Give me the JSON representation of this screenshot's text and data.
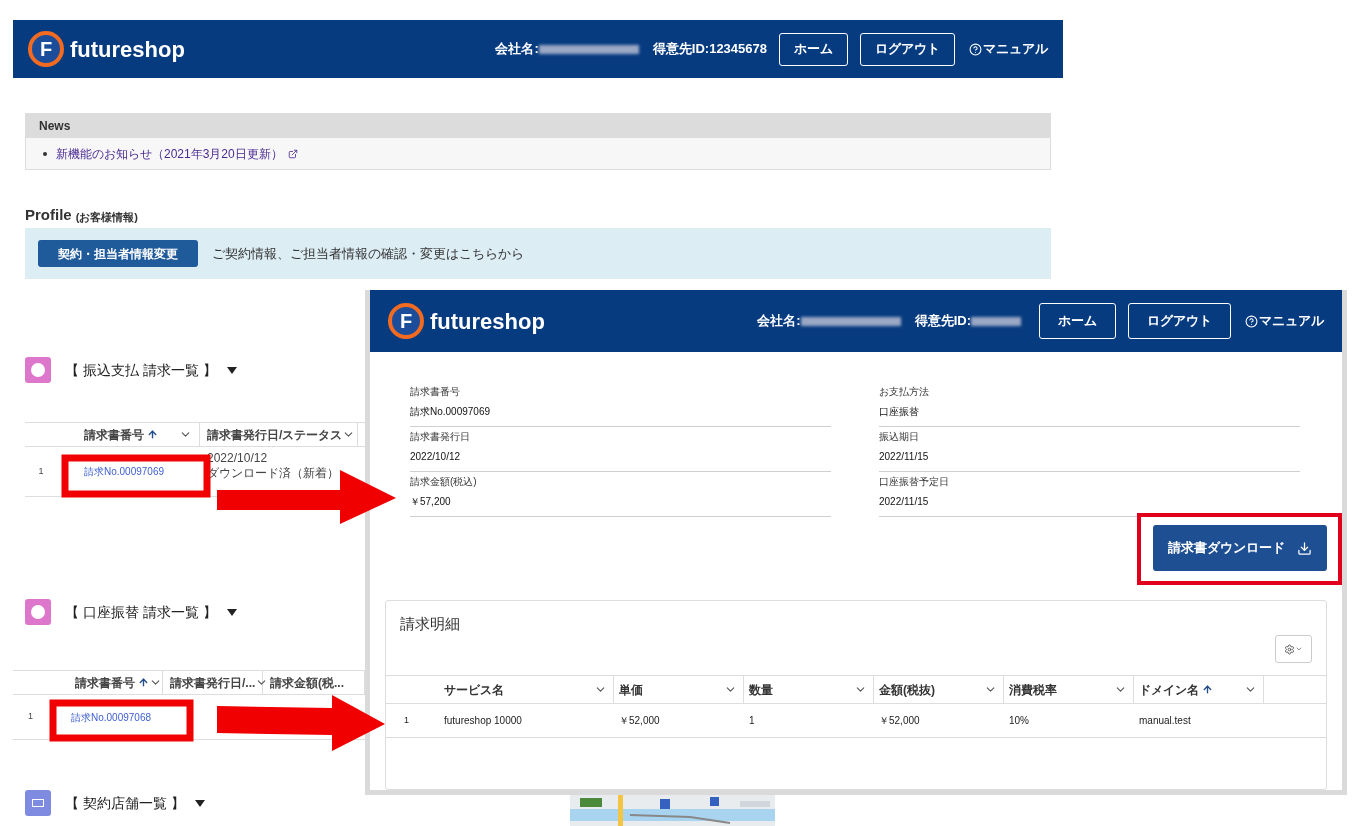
{
  "header": {
    "logo_letter": "F",
    "brand": "futureshop",
    "company_label": "会社名:",
    "customer_id": "得意先ID:12345678",
    "buttons": [
      "ホーム",
      "ログアウト"
    ],
    "manual": "マニュアル"
  },
  "news": {
    "title": "News",
    "items": [
      {
        "text": "新機能のお知らせ（2021年3月20日更新）"
      }
    ]
  },
  "profile": {
    "title": "Profile",
    "subtitle": "(お客様情報)",
    "button": "契約・担当者情報変更",
    "description": "ご契約情報、ご担当者情報の確認・変更はこちらから"
  },
  "sections": [
    {
      "kind": "circle",
      "title": "【 振込支払 請求一覧 】",
      "columns": [
        {
          "label": "請求書番号",
          "sorted": true
        },
        {
          "label": "請求書発行日/ステータス",
          "sorted": false
        }
      ],
      "rows": [
        {
          "index": "1",
          "invoice": "請求No.00097069",
          "date": "2022/10/12",
          "status": "ダウンロード済（新着）"
        }
      ]
    },
    {
      "kind": "circle",
      "title": "【 口座振替 請求一覧 】",
      "columns": [
        {
          "label": "請求書番号",
          "sorted": true
        },
        {
          "label": "請求書発行日/...",
          "sorted": false
        },
        {
          "label": "請求金額(税...",
          "sorted": false
        }
      ],
      "rows": [
        {
          "index": "1",
          "invoice": "請求No.00097068"
        }
      ]
    },
    {
      "kind": "grid",
      "title": "【 契約店舗一覧 】"
    }
  ],
  "detail": {
    "header": {
      "logo_letter": "F",
      "brand": "futureshop",
      "company_label": "会社名:",
      "customer_label": "得意先ID:",
      "buttons": [
        "ホーム",
        "ログアウト"
      ],
      "manual": "マニュアル"
    },
    "left_fields": [
      {
        "label": "請求書番号",
        "value": "請求No.00097069"
      },
      {
        "label": "請求書発行日",
        "value": "2022/10/12"
      },
      {
        "label": "請求金額(税込)",
        "value": "￥57,200"
      }
    ],
    "right_fields": [
      {
        "label": "お支払方法",
        "value": "口座振替"
      },
      {
        "label": "振込期日",
        "value": "2022/11/15"
      },
      {
        "label": "口座振替予定日",
        "value": "2022/11/15"
      }
    ],
    "download_button": "請求書ダウンロード",
    "breakdown": {
      "title": "請求明細",
      "columns": [
        {
          "label": "サービス名",
          "sorted": false
        },
        {
          "label": "単価",
          "sorted": false
        },
        {
          "label": "数量",
          "sorted": false
        },
        {
          "label": "金額(税抜)",
          "sorted": false
        },
        {
          "label": "消費税率",
          "sorted": false
        },
        {
          "label": "ドメイン名",
          "sorted": true
        }
      ],
      "rows": [
        {
          "index": "1",
          "cells": [
            "futureshop 10000",
            "￥52,000",
            "1",
            "￥52,000",
            "10%",
            "manual.test"
          ]
        }
      ]
    }
  }
}
